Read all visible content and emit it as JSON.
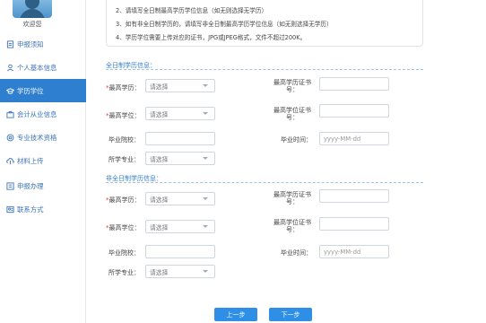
{
  "sidebar": {
    "welcome": "欢迎您",
    "items": [
      {
        "label": "申报须知",
        "icon": "document-icon"
      },
      {
        "label": "个人基本信息",
        "icon": "user-icon"
      },
      {
        "label": "学历学位",
        "icon": "graduation-cap-icon"
      },
      {
        "label": "会计从业信息",
        "icon": "briefcase-icon"
      },
      {
        "label": "专业技术资格",
        "icon": "badge-icon"
      },
      {
        "label": "材料上传",
        "icon": "upload-icon"
      },
      {
        "label": "申报办理",
        "icon": "form-icon"
      },
      {
        "label": "联系方式",
        "icon": "contact-icon"
      }
    ]
  },
  "notice": {
    "line2": "2、请填写全日制最高学历学位信息（如无则选择无学历）",
    "line3": "3、如有非全日制学历的，请填写非全日制最高学历学位信息（如无则选择无学历）",
    "line4": "4、学历学位需要上传对应的证书，JPG或JPEG格式，文件不超过200K。"
  },
  "fulltime": {
    "title": "全日制学历信息：",
    "education_label": "最高学历：",
    "degree_label": "最高学位：",
    "edu_cert_label": "最高学历证书号：",
    "deg_cert_label": "最高学位证书号：",
    "school_label": "毕业院校：",
    "grad_time_label": "毕业时间：",
    "major_label": "所学专业：",
    "select_placeholder": "请选择",
    "date_placeholder": "yyyy-MM-dd"
  },
  "parttime": {
    "title": "非全日制学历信息：",
    "education_label": "最高学历：",
    "degree_label": "最高学位：",
    "edu_cert_label": "最高学历证书号：",
    "deg_cert_label": "最高学位证书号：",
    "school_label": "毕业院校：",
    "grad_time_label": "毕业时间：",
    "major_label": "所学专业：",
    "select_placeholder": "请选择",
    "date_placeholder": "yyyy-MM-dd"
  },
  "buttons": {
    "prev": "上一步",
    "next": "下一步"
  },
  "colors": {
    "accent": "#2f7fd0",
    "button": "#2f8fe6",
    "required": "#e23b3b"
  }
}
